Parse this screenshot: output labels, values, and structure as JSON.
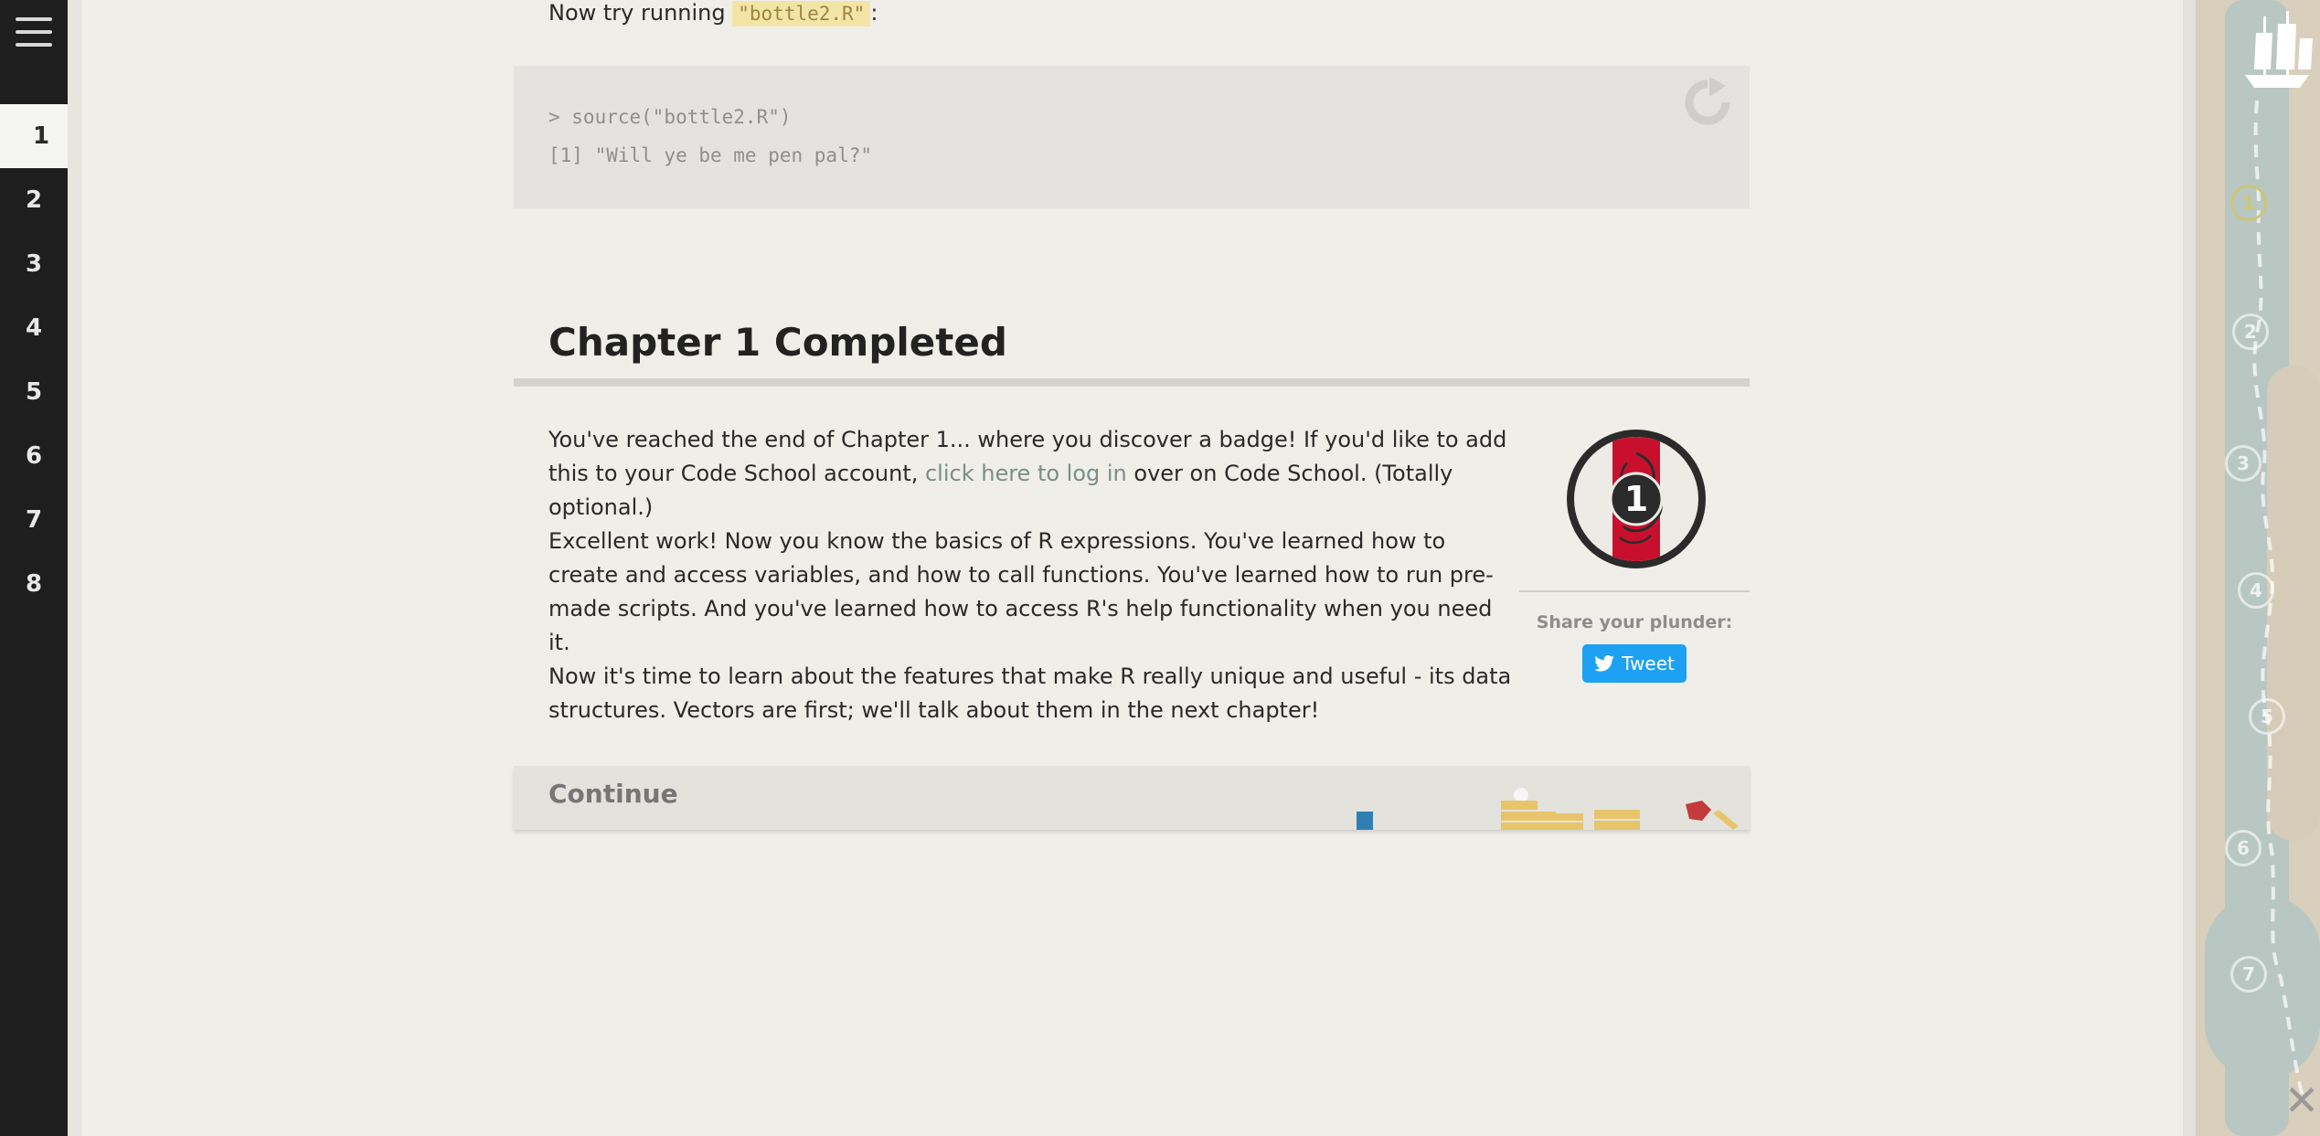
{
  "nav": {
    "chapters": [
      "1",
      "2",
      "3",
      "4",
      "5",
      "6",
      "7",
      "8"
    ],
    "active_index": 0
  },
  "intro": {
    "text_before": "Now try running ",
    "code": "\"bottle2.R\"",
    "text_after": ":"
  },
  "console": {
    "lines": [
      "> source(\"bottle2.R\")",
      "[1] \"Will ye be me pen pal?\""
    ]
  },
  "completion": {
    "title": "Chapter 1 Completed",
    "p1_before": "You've reached the end of Chapter 1... where you discover a badge! If you'd like to add this to your Code School account, ",
    "p1_link": "click here to log in",
    "p1_after": " over on Code School. (Totally optional.)",
    "p2": "Excellent work! Now you know the basics of R expressions. You've learned how to create and access variables, and how to call functions. You've learned how to run pre-made scripts. And you've learned how to access R's help functionality when you need it.",
    "p3": "Now it's time to learn about the features that make R really unique and useful - its data structures. Vectors are first; we'll talk about them in the next chapter!",
    "badge_number": "1",
    "share_label": "Share your plunder:",
    "tweet_label": "Tweet",
    "continue_label": "Continue"
  },
  "map": {
    "markers": [
      "1",
      "2",
      "3",
      "4",
      "5",
      "6",
      "7"
    ],
    "active_index": 0
  },
  "colors": {
    "page_bg": "#efeee9",
    "nav_bg": "#1e1e1e",
    "link": "#7a8e8a",
    "tweet": "#1da1f2",
    "badge_red": "#c8102e",
    "marker_active": "#cbc777"
  }
}
